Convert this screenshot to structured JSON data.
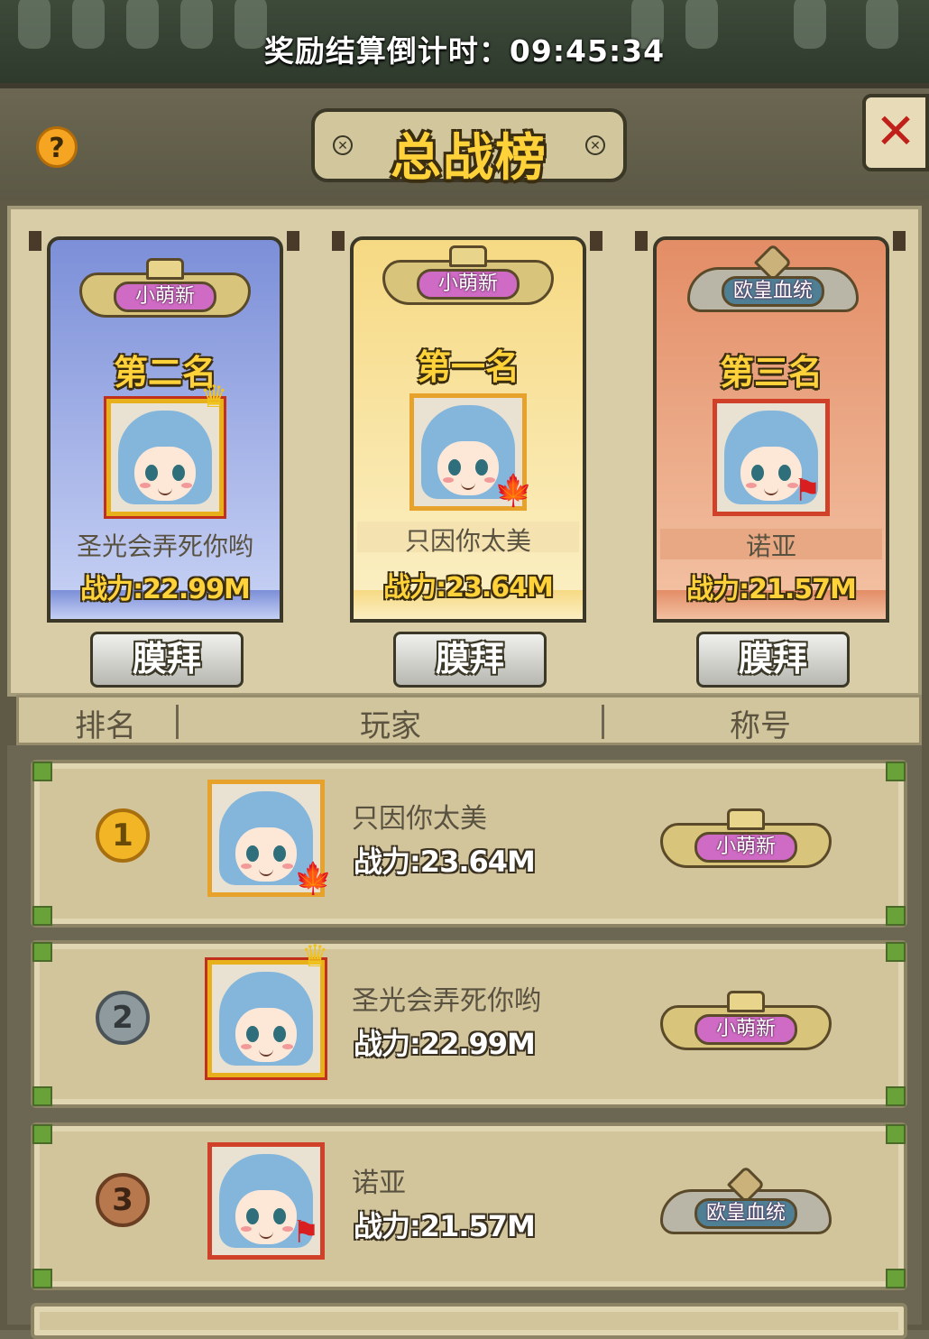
{
  "countdown": {
    "label": "奖励结算倒计时：",
    "time": "09:45:34"
  },
  "header": {
    "title": "总战榜",
    "help_icon": "?",
    "close_icon": "✕"
  },
  "podium": [
    {
      "rank_label": "第二名",
      "badge": "小萌新",
      "name": "圣光会弄死你哟",
      "power": "战力:22.99M",
      "worship": "膜拜",
      "color": "#8fa0e0"
    },
    {
      "rank_label": "第一名",
      "badge": "小萌新",
      "name": "只因你太美",
      "power": "战力:23.64M",
      "worship": "膜拜",
      "color": "#f6d983"
    },
    {
      "rank_label": "第三名",
      "badge": "欧皇血统",
      "name": "诺亚",
      "power": "战力:21.57M",
      "worship": "膜拜",
      "color": "#e38d66"
    }
  ],
  "table": {
    "headers": {
      "rank": "排名",
      "player": "玩家",
      "title": "称号"
    },
    "rows": [
      {
        "rank": "1",
        "name": "只因你太美",
        "power": "战力:23.64M",
        "badge": "小萌新",
        "medal_color": "#f2b526"
      },
      {
        "rank": "2",
        "name": "圣光会弄死你哟",
        "power": "战力:22.99M",
        "badge": "小萌新",
        "medal_color": "#8f9a9e"
      },
      {
        "rank": "3",
        "name": "诺亚",
        "power": "战力:21.57M",
        "badge": "欧皇血统",
        "medal_color": "#b8784e"
      }
    ]
  }
}
